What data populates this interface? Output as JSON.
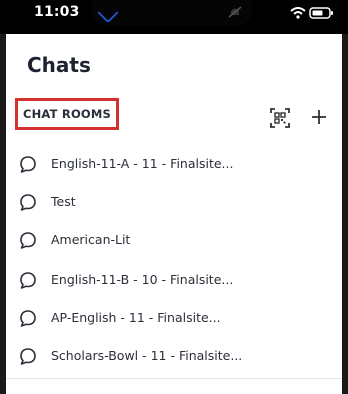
{
  "status_bar": {
    "time": "11:03"
  },
  "header": {
    "title": "Chats"
  },
  "section": {
    "label": "CHAT ROOMS"
  },
  "rooms": [
    {
      "name": "English-11-A - 11 - Finalsite..."
    },
    {
      "name": "Test"
    },
    {
      "name": "American-Lit"
    },
    {
      "name": "English-11-B - 10 - Finalsite..."
    },
    {
      "name": "AP-English - 11 - Finalsite..."
    },
    {
      "name": "Scholars-Bowl - 11 - Finalsite..."
    }
  ],
  "icons": {
    "qr": "qr-scan-icon",
    "add": "plus-icon",
    "room": "chat-bubble-icon"
  },
  "colors": {
    "highlight_border": "#d2312e",
    "text": "#2b2f3a"
  }
}
